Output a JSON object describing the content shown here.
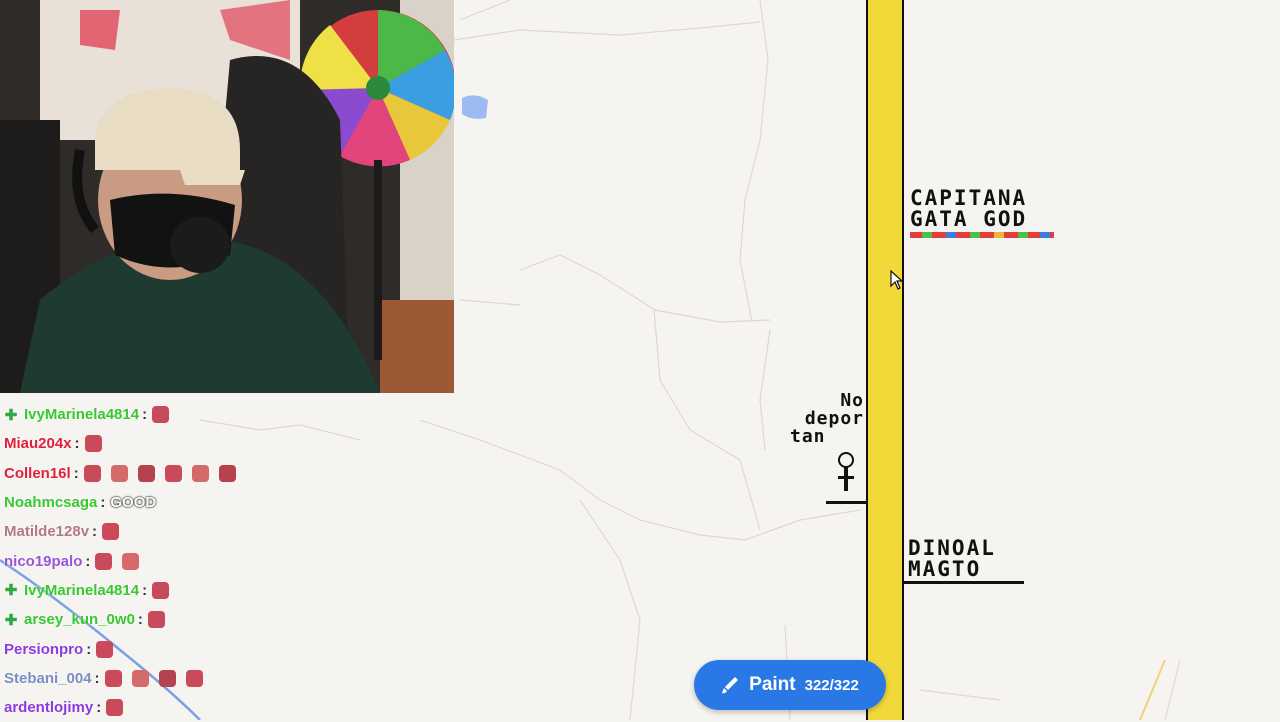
{
  "chat": {
    "messages": [
      {
        "user": "IvyMarinela4814",
        "color": "#38c82f",
        "badge": true,
        "text": "",
        "emotes": 1
      },
      {
        "user": "Miau204x",
        "color": "#e0203c",
        "badge": false,
        "text": "",
        "emotes": 1
      },
      {
        "user": "Collen16l",
        "color": "#e0203c",
        "badge": false,
        "text": "",
        "emotes": 6
      },
      {
        "user": "Noahmcsaga",
        "color": "#38c82f",
        "badge": false,
        "text": "GOOD",
        "emotes": 0
      },
      {
        "user": "Matilde128v",
        "color": "#b47a84",
        "badge": false,
        "text": "",
        "emotes": 1
      },
      {
        "user": "nico19palo",
        "color": "#9a56d6",
        "badge": false,
        "text": "",
        "emotes": 2
      },
      {
        "user": "IvyMarinela4814",
        "color": "#38c82f",
        "badge": true,
        "text": "",
        "emotes": 1
      },
      {
        "user": "arsey_kun_0w0",
        "color": "#38c82f",
        "badge": true,
        "text": "",
        "emotes": 1
      },
      {
        "user": "Persionpro",
        "color": "#8d3be0",
        "badge": false,
        "text": "",
        "emotes": 1
      },
      {
        "user": "Stebani_004",
        "color": "#7b8fc4",
        "badge": false,
        "text": "",
        "emotes": 4
      },
      {
        "user": "ardentlojimy",
        "color": "#8d3be0",
        "badge": false,
        "text": "",
        "emotes": 1
      }
    ]
  },
  "canvas": {
    "text1_line1": "CAPITANA",
    "text1_line2": "GATA GOD",
    "text2_line1": "No",
    "text2_line2": "depor",
    "text2_line3": "tan",
    "text3_line1": "DINOAL",
    "text3_line2": "MAGTO"
  },
  "paint": {
    "label": "Paint",
    "count": "322/322"
  },
  "colors": {
    "accent": "#2a77e6",
    "strip": "#f2d93a"
  }
}
